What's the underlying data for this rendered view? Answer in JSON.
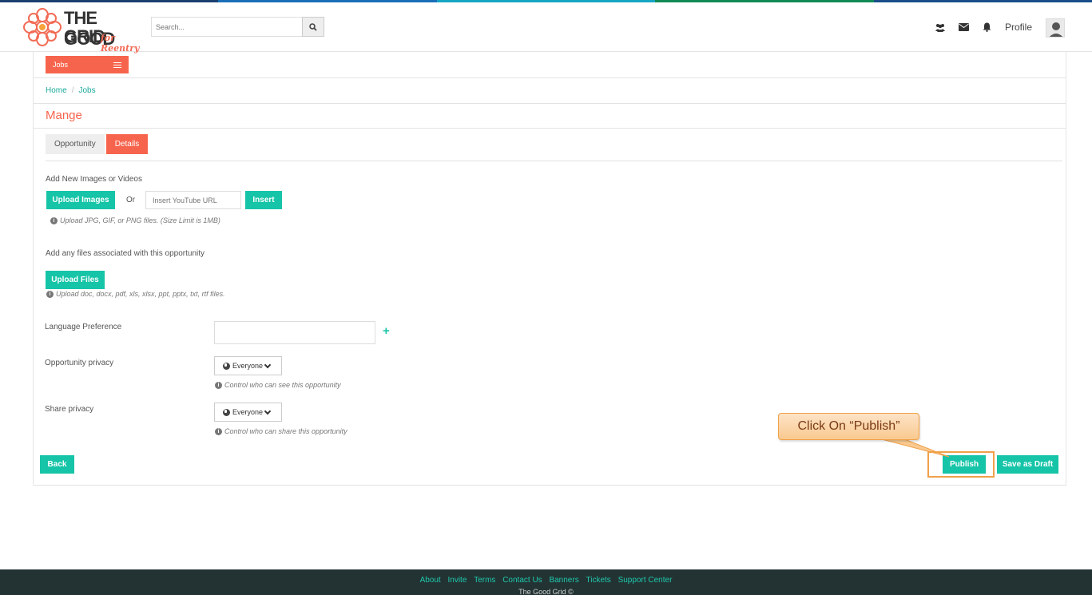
{
  "colors": {
    "accent": "#f7644d",
    "teal": "#16c4a8",
    "footer_bg": "#233333",
    "topbar": [
      "#1a3e6e",
      "#1a6eb8",
      "#16a6c4",
      "#0f8a55",
      "#1a4e8a"
    ]
  },
  "header": {
    "logo": {
      "line1": "THE GOOD",
      "line2": "GRID",
      "sub": "for Reentry",
      "icon": "flower-logo-icon"
    },
    "search": {
      "placeholder": "Search...",
      "icon": "search-icon"
    },
    "icons": [
      "users-icon",
      "envelope-icon",
      "bell-icon"
    ],
    "profile_label": "Profile",
    "avatar_icon": "user-avatar-icon"
  },
  "nav": {
    "jobs_label": "Jobs",
    "menu_icon": "menu-icon"
  },
  "breadcrumb": {
    "items": [
      "Home",
      "Jobs"
    ],
    "separator": "/"
  },
  "page_title": "Mange",
  "tabs": [
    {
      "label": "Opportunity",
      "active": false
    },
    {
      "label": "Details",
      "active": true
    }
  ],
  "media": {
    "label": "Add New Images or Videos",
    "upload_images_label": "Upload Images",
    "or_label": "Or",
    "youtube_placeholder": "Insert YouTube URL",
    "insert_label": "Insert",
    "hint": "Upload JPG, GIF, or PNG files. (Size Limit is 1MB)"
  },
  "files": {
    "label": "Add any files associated with this opportunity",
    "upload_files_label": "Upload Files",
    "hint": "Upload doc, docx, pdf, xls, xlsx, ppt, pptx, txt, rtf files."
  },
  "language": {
    "label": "Language Preference",
    "value": "",
    "add_icon": "plus-icon"
  },
  "opportunity_privacy": {
    "label": "Opportunity privacy",
    "selected": "Everyone",
    "hint": "Control who can see this opportunity"
  },
  "share_privacy": {
    "label": "Share privacy",
    "selected": "Everyone",
    "hint": "Control who can share this opportunity"
  },
  "actions": {
    "back_label": "Back",
    "publish_label": "Publish",
    "save_draft_label": "Save as Draft"
  },
  "callout": {
    "text": "Click On “Publish”"
  },
  "footer": {
    "links": [
      "About",
      "Invite",
      "Terms",
      "Contact Us",
      "Banners",
      "Tickets",
      "Support Center"
    ],
    "copyright": "The Good Grid ©"
  }
}
